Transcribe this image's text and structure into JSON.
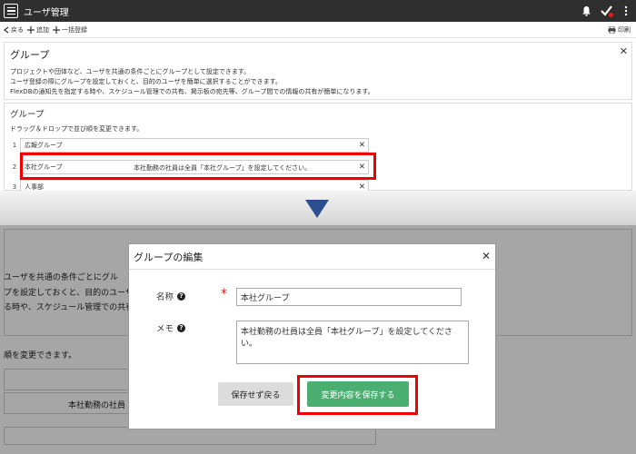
{
  "app": {
    "title": "ユーザ管理"
  },
  "toolbar": {
    "back": "戻る",
    "add": "追加",
    "bulk": "一括登録",
    "print": "印刷"
  },
  "intro": {
    "title": "グループ",
    "lines": [
      "プロジェクトや団体など、ユーザを共通の条件ごとにグループとして設定できます。",
      "ユーザ登録の際にグループを設定しておくと、目的のユーザを簡単に選択することができます。",
      "FlexDBの通知先を指定する時や、スケジュール管理での共有、掲示板の宛先等、グループ間での情報の共有が簡単になります。"
    ]
  },
  "groups": {
    "title": "グループ",
    "hint": "ドラッグ＆ドロップで並び順を変更できます。",
    "rows": [
      {
        "num": "1",
        "name": "広報グループ",
        "memo": ""
      },
      {
        "num": "2",
        "name": "本社グループ",
        "memo": "本社勤務の社員は全員「本社グループ」を設定してください。"
      },
      {
        "num": "3",
        "name": "人事部",
        "memo": ""
      }
    ]
  },
  "background": {
    "line1": "ユーザを共通の条件ごとにグル",
    "line2": "プを設定しておくと、目的のユーザ",
    "line3": "る時や、スケジュール管理での共有",
    "line4": "順を変更できます。",
    "line5": "本社勤務の社員"
  },
  "modal": {
    "title": "グループの編集",
    "name_label": "名称",
    "memo_label": "メモ",
    "required_mark": "*",
    "name_value": "本社グループ",
    "memo_value": "本社勤務の社員は全員「本社グループ」を設定してください。",
    "back_button": "保存せず戻る",
    "save_button": "変更内容を保存する"
  },
  "colors": {
    "topbar": "#2f2f2f",
    "accent_arrow": "#2b4e8f",
    "save": "#4caf72",
    "highlight": "#ee0000"
  }
}
